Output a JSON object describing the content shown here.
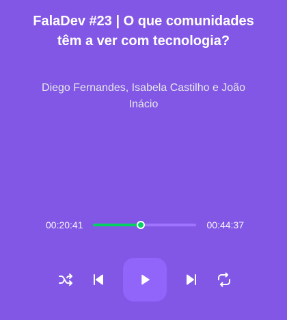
{
  "episode": {
    "title": "FalaDev #23 | O que comunidades têm a ver com tecnologia?",
    "members": "Diego Fernandes, Isabela Castilho e João Inácio"
  },
  "progress": {
    "current_time": "00:20:41",
    "total_time": "00:44:37",
    "fraction": 0.464
  },
  "controls": {
    "shuffle_icon": "shuffle-icon",
    "previous_icon": "skip-back-icon",
    "play_icon": "play-icon",
    "next_icon": "skip-forward-icon",
    "repeat_icon": "repeat-icon"
  },
  "colors": {
    "background": "#8257e5",
    "play_button": "#9164fa",
    "progress": "#04d361",
    "track": "#9f75ff"
  }
}
